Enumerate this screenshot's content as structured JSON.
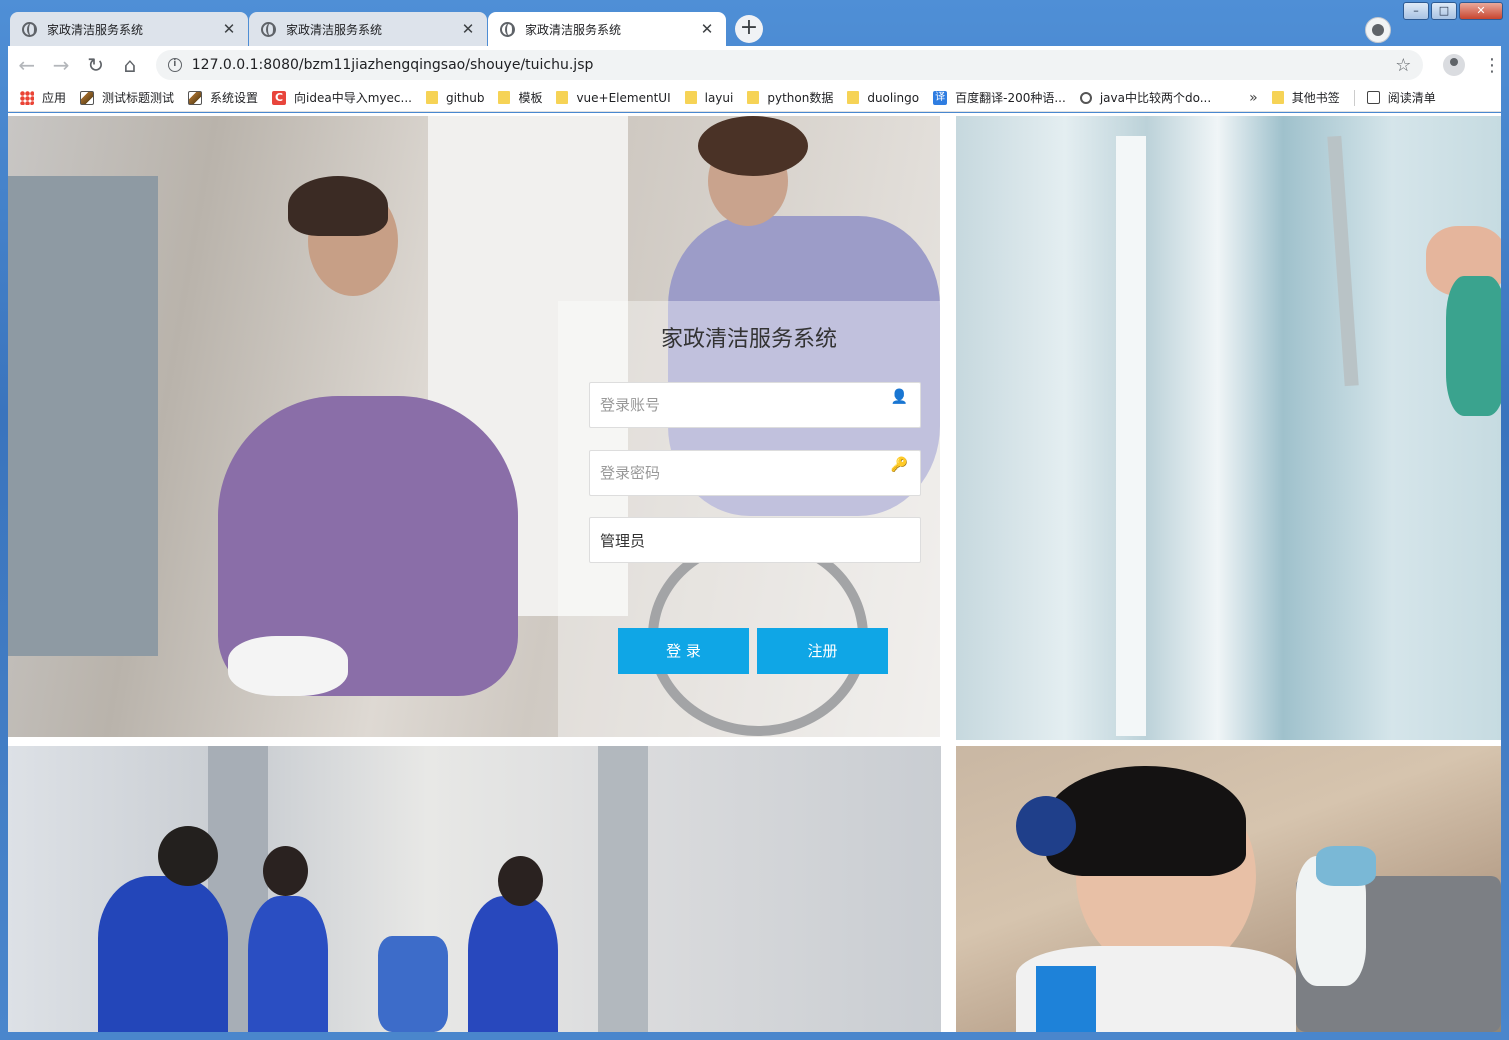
{
  "browser": {
    "tabs": [
      {
        "title": "家政清洁服务系统",
        "active": false
      },
      {
        "title": "家政清洁服务系统",
        "active": false
      },
      {
        "title": "家政清洁服务系统",
        "active": true
      }
    ],
    "url": "127.0.0.1:8080/bzm11jiazhengqingsao/shouye/tuichu.jsp",
    "bookmarks": [
      {
        "label": "应用",
        "icon": "apps-grid-icon"
      },
      {
        "label": "测试标题测试",
        "icon": "image-icon"
      },
      {
        "label": "系统设置",
        "icon": "image-icon"
      },
      {
        "label": "向idea中导入myec...",
        "icon": "c-icon"
      },
      {
        "label": "github",
        "icon": "folder-icon"
      },
      {
        "label": "模板",
        "icon": "folder-icon"
      },
      {
        "label": "vue+ElementUI",
        "icon": "folder-icon"
      },
      {
        "label": "layui",
        "icon": "folder-icon"
      },
      {
        "label": "python数据",
        "icon": "folder-icon"
      },
      {
        "label": "duolingo",
        "icon": "folder-icon"
      },
      {
        "label": "百度翻译-200种语...",
        "icon": "translate-icon"
      },
      {
        "label": "java中比较两个do...",
        "icon": "java-icon"
      }
    ],
    "overflow": "»",
    "other_bookmarks": "其他书签",
    "reading_list": "阅读清单"
  },
  "login": {
    "title": "家政清洁服务系统",
    "username_placeholder": "登录账号",
    "password_placeholder": "登录密码",
    "role_value": "管理员",
    "login_label": "登 录",
    "register_label": "注册"
  },
  "colors": {
    "primary_button": "#0fa6e6",
    "panel_overlay": "rgba(255,255,255,0.38)"
  }
}
